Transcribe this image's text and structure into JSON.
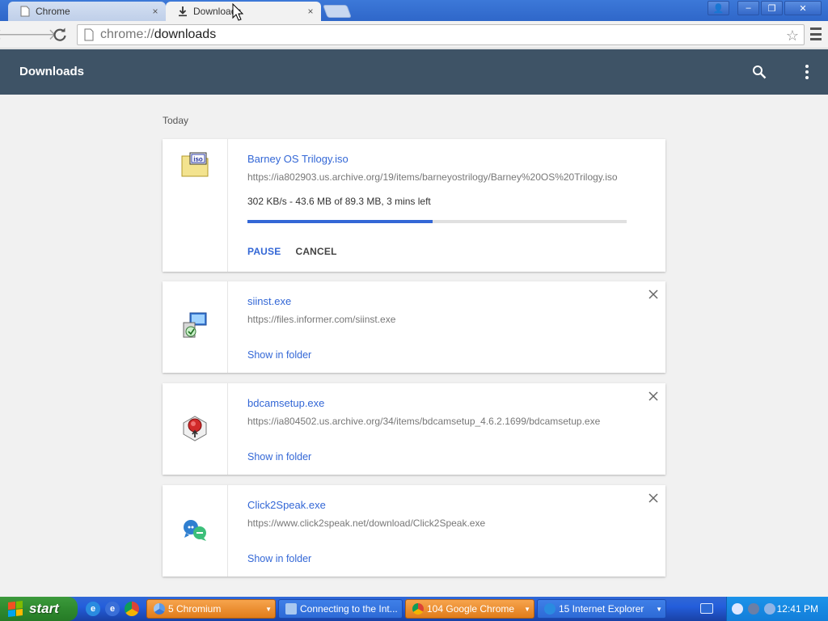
{
  "browser": {
    "tabs": [
      {
        "title": "Chrome",
        "close": "×"
      },
      {
        "title": "Downloads",
        "close": "×"
      }
    ],
    "window_controls": {
      "user": "👤",
      "minimize": "–",
      "restore": "❐",
      "close": "✕"
    },
    "address": {
      "scheme": "chrome://",
      "host": "downloads"
    },
    "accent": "#3e5366"
  },
  "header": {
    "title": "Downloads",
    "search_icon": "search-icon",
    "more_icon": "more-vert-icon"
  },
  "date_group": "Today",
  "downloads": [
    {
      "name": "Barney OS Trilogy.iso",
      "url": "https://ia802903.us.archive.org/19/items/barneyostrilogy/Barney%20OS%20Trilogy.iso",
      "status": "302 KB/s - 43.6 MB of 89.3 MB, 3 mins left",
      "progress": 0.488,
      "pause": "PAUSE",
      "cancel": "CANCEL",
      "icon": "iso-file-icon"
    },
    {
      "name": "siinst.exe",
      "url": "https://files.informer.com/siinst.exe",
      "show_in_folder": "Show in folder",
      "icon": "installer-icon"
    },
    {
      "name": "bdcamsetup.exe",
      "url": "https://ia804502.us.archive.org/34/items/bdcamsetup_4.6.2.1699/bdcamsetup.exe",
      "show_in_folder": "Show in folder",
      "icon": "bandicam-icon"
    },
    {
      "name": "Click2Speak.exe",
      "url": "https://www.click2speak.net/download/Click2Speak.exe",
      "show_in_folder": "Show in folder",
      "icon": "click2speak-icon"
    }
  ],
  "taskbar": {
    "start": "start",
    "tasks": [
      {
        "label": "5 Chromium",
        "style": "group"
      },
      {
        "label": "Connecting to the Int...",
        "style": "normal"
      },
      {
        "label": "104 Google Chrome",
        "style": "group"
      },
      {
        "label": "15 Internet Explorer",
        "style": "normal"
      }
    ],
    "clock": "12:41 PM"
  }
}
